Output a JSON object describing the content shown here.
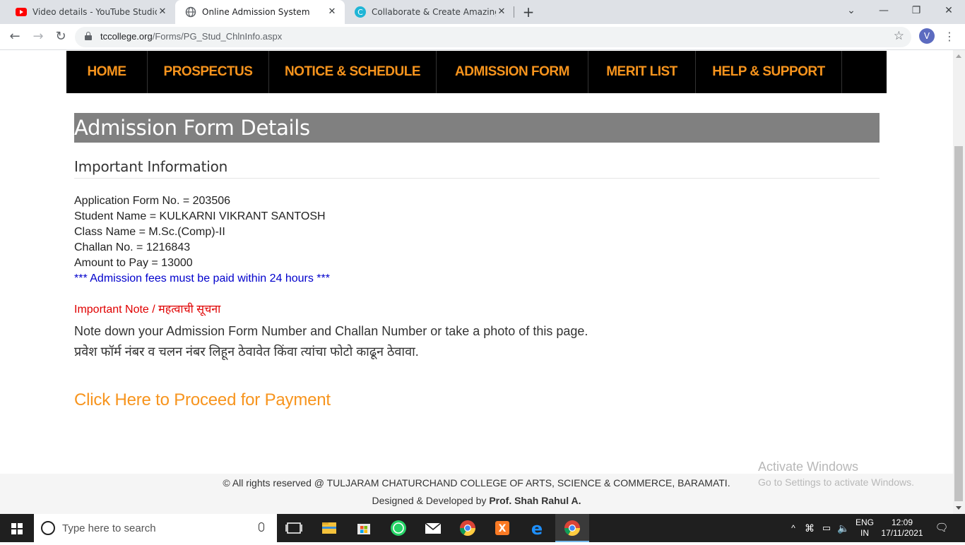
{
  "browser": {
    "tabs": [
      {
        "title": "Video details - YouTube Studio",
        "favicon": "youtube-icon",
        "active": false
      },
      {
        "title": "Online Admission System",
        "favicon": "globe-icon",
        "active": true
      },
      {
        "title": "Collaborate & Create Amazing G",
        "favicon": "canva-icon",
        "active": false
      }
    ],
    "url_domain": "tccollege.org",
    "url_path": "/Forms/PG_Stud_ChlnInfo.aspx",
    "profile_initial": "V"
  },
  "nav": {
    "items": [
      "HOME",
      "PROSPECTUS",
      "NOTICE & SCHEDULE",
      "ADMISSION FORM",
      "MERIT LIST",
      "HELP & SUPPORT"
    ]
  },
  "page": {
    "title": "Admission Form Details",
    "section_title": "Important Information",
    "info_lines": [
      "Application Form No. = 203506",
      "Student Name = KULKARNI VIKRANT SANTOSH",
      "Class Name = M.Sc.(Comp)-II",
      "Challan No. = 1216843",
      "Amount to Pay = 13000"
    ],
    "warning": "*** Admission fees must be paid within 24 hours ***",
    "important_note_label": "Important Note / महत्वाची सूचना",
    "note_en": "Note down your Admission Form Number and Challan Number or take a photo of this page.",
    "note_mr": "प्रवेश फॉर्म नंबर व चलन नंबर लिहून ठेवावेत किंवा त्यांचा फोटो काढून ठेवावा.",
    "payment_link": "Click Here to Proceed for Payment"
  },
  "footer": {
    "copyright": "© All rights reserved @ TULJARAM CHATURCHAND COLLEGE OF ARTS, SCIENCE & COMMERCE, BARAMATI.",
    "designed_prefix": "Designed & Developed by",
    "designer": "Prof. Shah Rahul A."
  },
  "watermark": {
    "line1": "Activate Windows",
    "line2": "Go to Settings to activate Windows."
  },
  "taskbar": {
    "search_placeholder": "Type here to search",
    "lang_top": "ENG",
    "lang_bottom": "IN",
    "time": "12:09",
    "date": "17/11/2021"
  },
  "colors": {
    "nav_bg": "#000000",
    "nav_text": "#f7941d",
    "heading_bar": "#808080",
    "warning_text": "#0000cc",
    "important_note": "#e00000",
    "payment_link": "#f7941d"
  }
}
